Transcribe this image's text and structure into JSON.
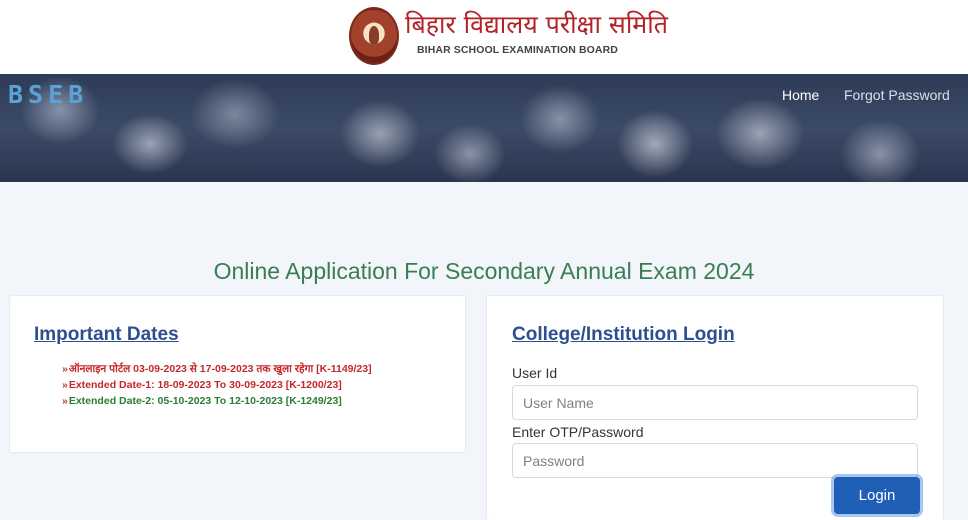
{
  "header": {
    "logo_hindi": "बिहार विद्यालय परीक्षा समिति",
    "logo_english": "BIHAR SCHOOL EXAMINATION BOARD"
  },
  "nav": {
    "brand": "BSEB",
    "home": "Home",
    "forgot_password": "Forgot Password"
  },
  "page_title": "Online Application For Secondary Annual Exam 2024",
  "important_dates": {
    "heading": "Important Dates",
    "items": [
      {
        "text": "ऑनलाइन पोर्टल 03-09-2023 से 17-09-2023 तक खुला रहेगा [K-1149/23]",
        "color": "#c62828"
      },
      {
        "text": "Extended Date-1: 18-09-2023 To 30-09-2023 [K-1200/23]",
        "color": "#c62828"
      },
      {
        "text": "Extended Date-2: 05-10-2023 To 12-10-2023 [K-1249/23]",
        "color": "#2e7d32"
      }
    ]
  },
  "login": {
    "heading": "College/Institution Login",
    "user_label": "User Id",
    "user_placeholder": "User Name",
    "user_value": "",
    "password_label": "Enter OTP/Password",
    "password_placeholder": "Password",
    "password_value": "",
    "button": "Login"
  },
  "colors": {
    "title_green": "#3a7d53",
    "heading_blue": "#2d4f8f",
    "button_blue": "#1f5fb5",
    "brand_blue": "#5ba3d6"
  }
}
